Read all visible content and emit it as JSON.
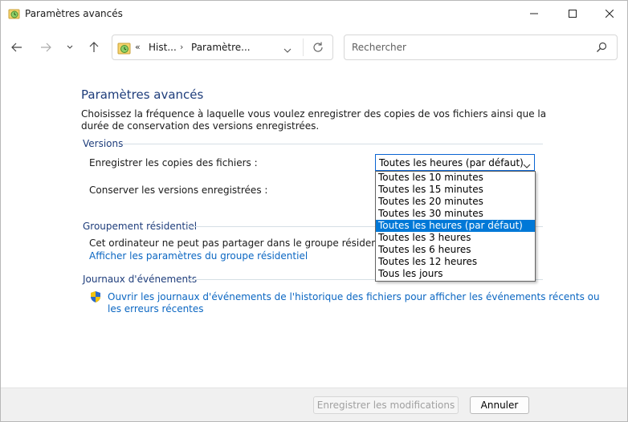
{
  "window": {
    "title": "Paramètres avancés"
  },
  "nav": {
    "breadcrumb_overflow": "«",
    "breadcrumb": [
      "Hist...",
      "Paramètre..."
    ],
    "breadcrumb_separator": "›",
    "search_placeholder": "Rechercher"
  },
  "page": {
    "title": "Paramètres avancés",
    "description": "Choisissez la fréquence à laquelle vous voulez enregistrer des copies de vos fichiers ainsi que la durée de conservation des versions enregistrées."
  },
  "versions": {
    "heading": "Versions",
    "save_copies_label": "Enregistrer les copies des fichiers :",
    "keep_versions_label": "Conserver les versions enregistrées :",
    "frequency_selected": "Toutes les heures (par défaut)",
    "frequency_options": [
      "Toutes les 10 minutes",
      "Toutes les 15 minutes",
      "Toutes les 20 minutes",
      "Toutes les 30 minutes",
      "Toutes les heures (par défaut)",
      "Toutes les 3 heures",
      "Toutes les 6 heures",
      "Toutes les 12 heures",
      "Tous les jours"
    ],
    "highlighted_index": 4
  },
  "homegroup": {
    "heading": "Groupement résidentiel",
    "message": "Cet ordinateur ne peut pas partager dans le groupe résidentiel.",
    "link": "Afficher les paramètres du groupe résidentiel"
  },
  "events": {
    "heading": "Journaux d'événements",
    "link_line1": "Ouvrir les journaux d'événements de l'historique des fichiers pour afficher les événements récents ou",
    "link_line2": "les erreurs récentes"
  },
  "footer": {
    "save_label": "Enregistrer les modifications",
    "cancel_label": "Annuler"
  },
  "colors": {
    "heading": "#1e3d7b",
    "link": "#0a66c2",
    "selection": "#0078d7"
  }
}
